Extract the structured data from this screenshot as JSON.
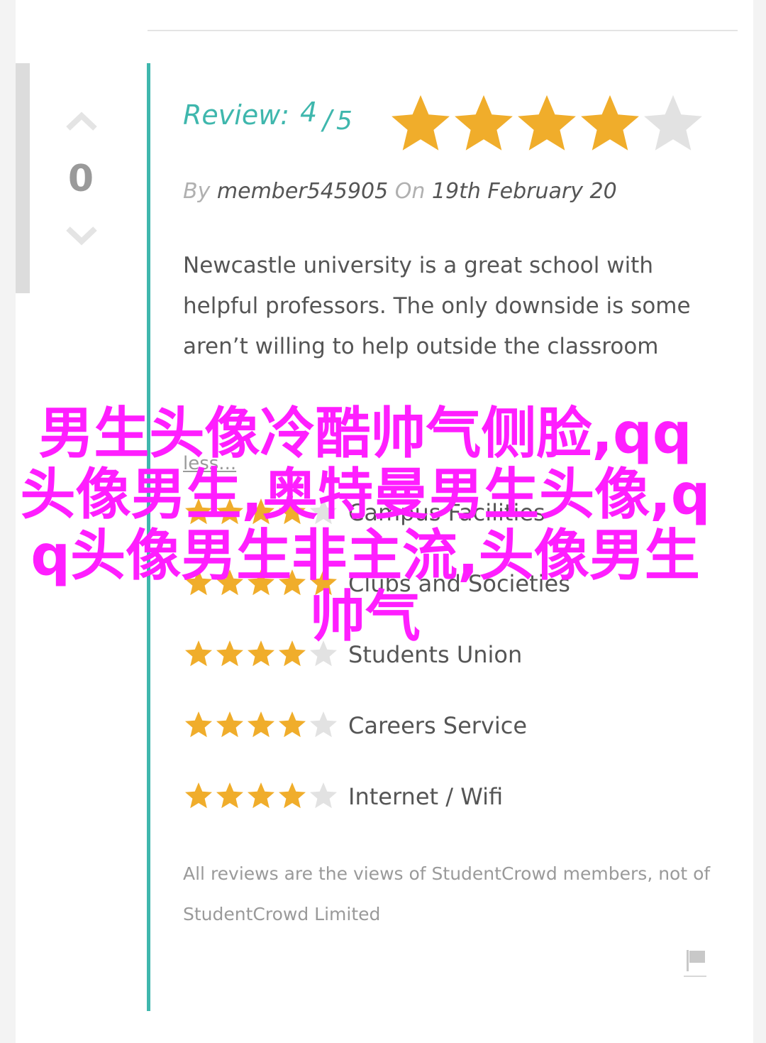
{
  "vote": {
    "count": "0",
    "up_icon": "chevron-up-icon",
    "down_icon": "chevron-down-icon"
  },
  "review": {
    "label": "Review:",
    "score": "4",
    "separator": "/",
    "max": "5",
    "rating": 4,
    "rating_max": 5,
    "by_label": "By",
    "author": "member545905",
    "on_label": "On",
    "date": "19th February 20",
    "text": "Newcastle university is a great school with helpful professors. The only downside is some aren’t willing to help outside the classroom",
    "less_link": "less..."
  },
  "categories": [
    {
      "label": "Campus Facilities",
      "rating": 4
    },
    {
      "label": "Clubs and Societies",
      "rating": 5
    },
    {
      "label": "Students Union",
      "rating": 4
    },
    {
      "label": "Careers Service",
      "rating": 4
    },
    {
      "label": "Internet / Wifi",
      "rating": 4
    }
  ],
  "disclaimer": "All reviews are the views of StudentCrowd members, not of StudentCrowd Limited",
  "flag_icon": "flag-icon",
  "overlay_text": "男生头像冷酷帅气侧脸,qq头像男生,奥特曼男生头像,qq头像男生非主流,头像男生帅气",
  "colors": {
    "accent": "#3fb7ad",
    "star_filled": "#f0ad2b",
    "star_empty": "#e2e2e2",
    "text": "#555555",
    "muted": "#9a9a9a",
    "overlay": "#ff1eff"
  }
}
